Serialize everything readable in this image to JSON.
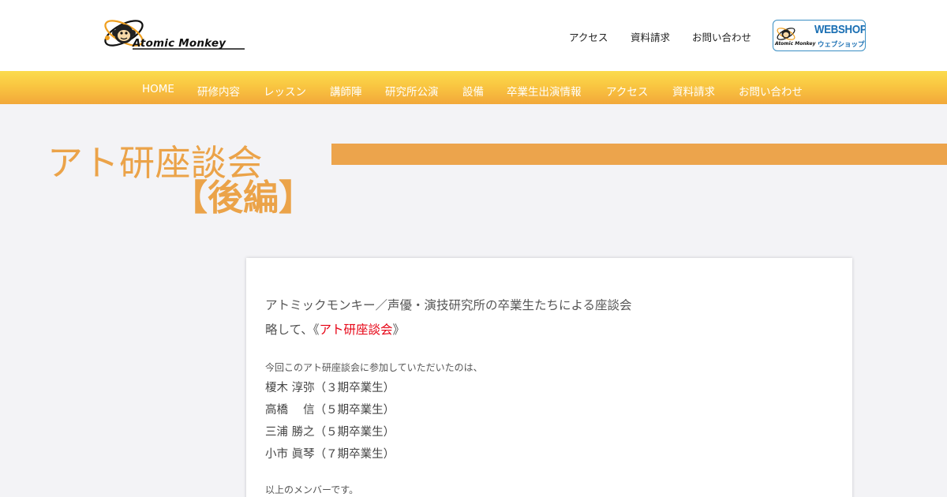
{
  "header": {
    "logo_text": "Atomic Monkey",
    "top_links": [
      "アクセス",
      "資料請求",
      "お問い合わせ"
    ],
    "webshop": {
      "logo_text": "Atomic Monkey",
      "title": "WEBSHOP",
      "subtitle": "ウェブショップ"
    }
  },
  "nav": {
    "items": [
      "HOME",
      "研修内容",
      "レッスン",
      "講師陣",
      "研究所公演",
      "設備",
      "卒業生出演情報",
      "アクセス",
      "資料請求",
      "お問い合わせ"
    ]
  },
  "page": {
    "title_line1": "アト研座談会",
    "title_line2": "【後編】"
  },
  "content": {
    "intro1": "アトミックモンキー／声優・演技研究所の卒業生たちによる座談会",
    "intro2_prefix": "略して、《",
    "intro2_highlight": "アト研座談会",
    "intro2_suffix": "》",
    "participants_intro": "今回このアト研座談会に参加していただいたのは、",
    "members": [
      "榎木 淳弥（３期卒業生）",
      "高橋　 信（５期卒業生）",
      "三浦 勝之（５期卒業生）",
      "小市 眞琴（７期卒業生）"
    ],
    "closing": "以上のメンバーです。"
  },
  "colors": {
    "accent_orange": "#eca44c",
    "nav_gradient_top": "#fbdc4e",
    "nav_gradient_bottom": "#f2a83a",
    "highlight_red": "#e60012",
    "webshop_blue": "#1a6fb3"
  }
}
